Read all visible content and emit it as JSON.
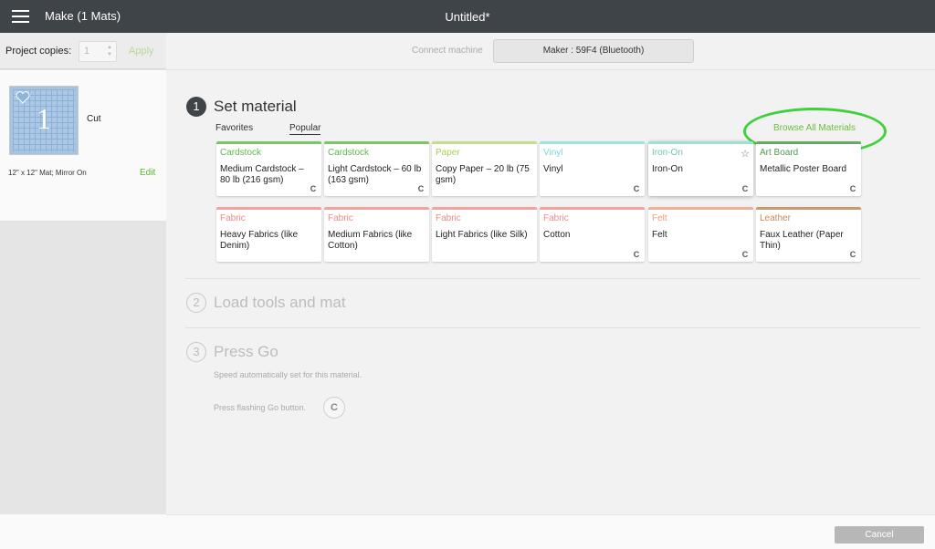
{
  "topbar": {
    "menu_icon": "hamburger-icon",
    "make_title": "Make (1 Mats)",
    "doc_title": "Untitled*"
  },
  "left": {
    "copies_label": "Project copies:",
    "copies_value": "1",
    "apply_label": "Apply",
    "mat": {
      "number": "1",
      "operation": "Cut",
      "description": "12\" x 12\" Mat; Mirror On",
      "edit_label": "Edit"
    }
  },
  "connect": {
    "label": "Connect machine",
    "machine": "Maker : 59F4 (Bluetooth)"
  },
  "steps": [
    {
      "num": "1",
      "title": "Set material"
    },
    {
      "num": "2",
      "title": "Load tools and mat"
    },
    {
      "num": "3",
      "title": "Press Go"
    }
  ],
  "tabs": {
    "favorites": "Favorites",
    "popular": "Popular"
  },
  "browse_label": "Browse All Materials",
  "materials": [
    {
      "category": "Cardstock",
      "name": "Medium Cardstock – 80 lb (216 gsm)",
      "bar": "#7cc36a",
      "cat_color": "#5cb84a"
    },
    {
      "category": "Cardstock",
      "name": "Light Cardstock – 60 lb (163 gsm)",
      "bar": "#7cc36a",
      "cat_color": "#5cb84a"
    },
    {
      "category": "Paper",
      "name": "Copy Paper – 20 lb (75 gsm)",
      "bar": "#c5dd8a",
      "cat_color": "#a9cf5a"
    },
    {
      "category": "Vinyl",
      "name": "Vinyl",
      "bar": "#9fe0e0",
      "cat_color": "#7fd3d3"
    },
    {
      "category": "Iron-On",
      "name": "Iron-On",
      "bar": "#9fe0d0",
      "cat_color": "#6cc8b0"
    },
    {
      "category": "Art Board",
      "name": "Metallic Poster Board",
      "bar": "#6aa86a",
      "cat_color": "#4f9a4f"
    },
    {
      "category": "Fabric",
      "name": "Heavy Fabrics (like Denim)",
      "bar": "#f3a39e",
      "cat_color": "#ef8a84"
    },
    {
      "category": "Fabric",
      "name": "Medium Fabrics (like Cotton)",
      "bar": "#f3a39e",
      "cat_color": "#ef8a84"
    },
    {
      "category": "Fabric",
      "name": "Light Fabrics (like Silk)",
      "bar": "#f3a39e",
      "cat_color": "#ef8a84"
    },
    {
      "category": "Fabric",
      "name": "Cotton",
      "bar": "#f3a39e",
      "cat_color": "#ef8a84"
    },
    {
      "category": "Felt",
      "name": "Felt",
      "bar": "#f2b196",
      "cat_color": "#ee9a77"
    },
    {
      "category": "Leather",
      "name": "Faux Leather (Paper Thin)",
      "bar": "#c99a6c",
      "cat_color": "#c48a55"
    }
  ],
  "step3": {
    "speed_text": "Speed automatically set for this material.",
    "go_text": "Press flashing Go button.",
    "go_icon": "cricut-c-icon"
  },
  "cancel_label": "Cancel",
  "colors": {
    "topbar": "#3f4449",
    "accent_green": "#6cbf3a",
    "highlight_oval": "#3ed13b"
  }
}
